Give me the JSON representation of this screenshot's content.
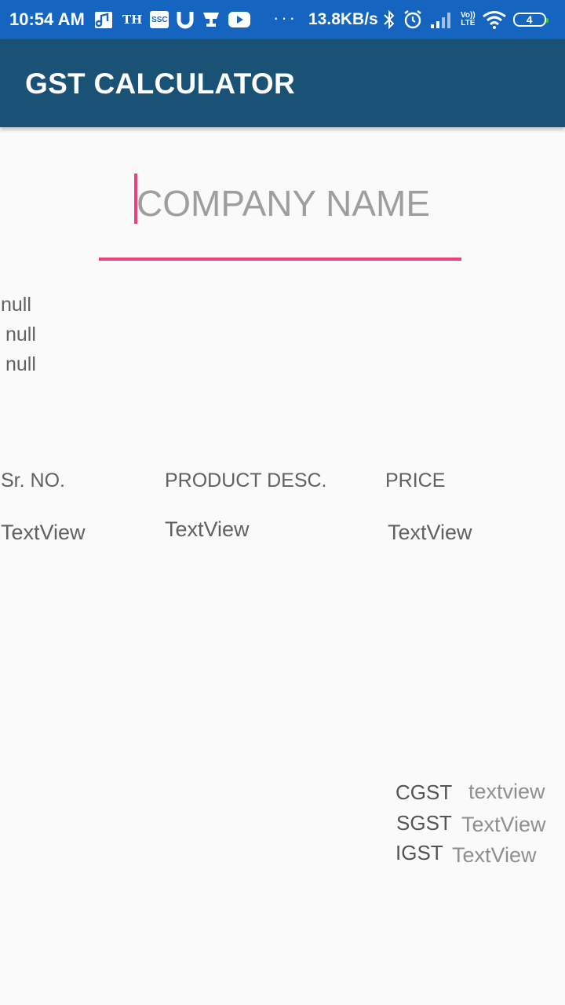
{
  "status_bar": {
    "time": "10:54 AM",
    "th_label": "TH",
    "ssc_label": "SSC",
    "dots": "···",
    "speed": "13.8KB/s",
    "volte_top": "Vo))",
    "volte_bottom": "LTE",
    "battery_level": "4"
  },
  "app_bar": {
    "title": "GST CALCULATOR"
  },
  "company": {
    "placeholder": "COMPANY NAME"
  },
  "info_lines": [
    "null",
    "null",
    "null"
  ],
  "table": {
    "headers": {
      "sr": "Sr. NO.",
      "desc": "PRODUCT DESC.",
      "price": "PRICE"
    },
    "row": {
      "sr": "TextView",
      "desc": "TextView",
      "price": "TextView"
    }
  },
  "taxes": {
    "cgst": {
      "label": "CGST",
      "value": "textview"
    },
    "sgst": {
      "label": "SGST",
      "value": "TextView"
    },
    "igst": {
      "label": "IGST",
      "value": "TextView"
    }
  },
  "colors": {
    "status_bar": "#1565c0",
    "app_bar": "#1a5276",
    "accent": "#ec407a",
    "background": "#fafafa"
  }
}
